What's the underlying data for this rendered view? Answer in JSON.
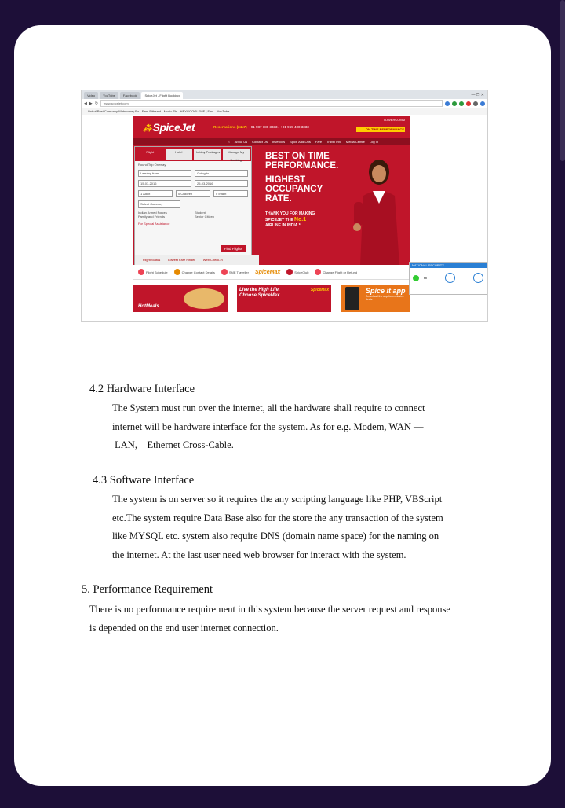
{
  "screenshot": {
    "tabs": [
      "Video",
      "YouTube",
      "Facebook",
      "SpiceJet - Flight Booking"
    ],
    "url": "www.spicejet.com",
    "bookmarks": "List of Post Company   Webmoney.Ro - Earn   Bitbeard - Music Sh...   HEYGOOGLEME | Find...   YouTube",
    "site": {
      "logo": "SpiceJet",
      "reservations": "Reservations (24x7)",
      "phones": "+91 987 180 3333  /  +91 965 400 3333",
      "badge_top": "TOWERCOMM",
      "badge_bottom": "ON TIME PERFORMANCE",
      "nav": [
        "About Us",
        "Contact Us",
        "Investors",
        "Spice Add-Ons",
        "Fare",
        "Travel Info",
        "Media Centre",
        "Log In"
      ],
      "form_tabs": [
        "Flight",
        "Hotel",
        "Holiday Packages",
        "Manage My Booking"
      ],
      "trip_type": "Round Trip  Oneway",
      "leaving_from": "Leaving from",
      "going_to": "Going to",
      "depart_date": "15-03-2016",
      "return_date": "25-03-2016",
      "pax": [
        "1 Adult",
        "0 Children",
        "0 Infant"
      ],
      "currency": "Select Currency",
      "options_left": "Indian Armed Forces",
      "options_left2": "Family and Friends",
      "options_right": "Student",
      "options_right2": "Senior Citizen",
      "special_assist": "For Special Assistance",
      "find_button": "Find Flights",
      "bottom_links": [
        "Flight Status",
        "Lowest Fare Finder",
        "Web Check-in"
      ],
      "hero_line1": "BEST ON TIME",
      "hero_line2": "PERFORMANCE.",
      "hero_line3": "HIGHEST",
      "hero_line4": "OCCUPANCY",
      "hero_line5": "RATE.",
      "thanks1": "THANK YOU FOR MAKING",
      "thanks2": "SPICEJET THE",
      "thanks_big": "No.1",
      "thanks3": "AIRLINE IN INDIA.*",
      "quick_links": [
        "Flight Schedule",
        "Change Contact Details",
        "SME Traveller",
        "SpiceMax",
        "SpiceClub",
        "Change Flight or Refund"
      ],
      "promo_hot": "HotMeals",
      "promo_sm1": "Live the High Life.",
      "promo_sm2": "Choose SpiceMax.",
      "promo_sm_brand": "SpiceMax",
      "promo_app": "Spice it app",
      "promo_app_sub": "Download the app for exclusive deals",
      "chat_title": "NATIONAL SECURITY",
      "chat_status": "Hi"
    }
  },
  "document": {
    "sec42_title": "4.2 Hardware Interface",
    "sec42_lines": [
      "The System must run over the internet,  all  the  hardware  shall  require to connect",
      "internet will  be hardware interface for the system. As for e.g. Modem, WAN —",
      " LAN,    Ethernet Cross-Cable."
    ],
    "sec43_title": "4.3 Software Interface",
    "sec43_lines": [
      "The system is on server so it requires the any scripting language like PHP, VBScript",
      "etc.The  system require Data Base also for the store the any transaction of the system",
      "like  MYSQL etc. system also require  DNS (domain name space) for the naming on",
      "the internet. At the last  user need web browser for interact with the system."
    ],
    "sec5_title": "5. Performance Requirement",
    "sec5_lines": [
      "There is no performance requirement in this system because the server request and response",
      "is depended on the end user internet connection."
    ]
  }
}
